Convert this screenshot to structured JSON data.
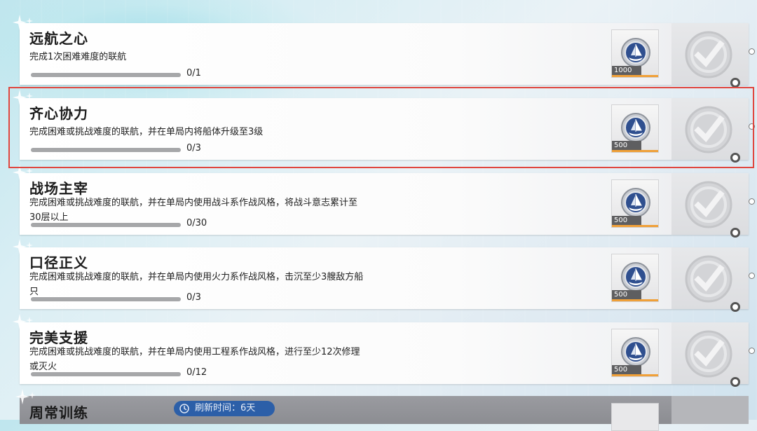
{
  "tasks": [
    {
      "title": "远航之心",
      "desc": "完成1次困难难度的联航",
      "progress_text": "0/1",
      "progress": 0,
      "reward_amount": "1000"
    },
    {
      "title": "齐心协力",
      "desc": "完成困难或挑战难度的联航，并在单局内将船体升级至3级",
      "progress_text": "0/3",
      "progress": 0,
      "reward_amount": "500"
    },
    {
      "title": "战场主宰",
      "desc": "完成困难或挑战难度的联航，并在单局内使用战斗系作战风格，将战斗意志累计至30层以上",
      "progress_text": "0/30",
      "progress": 0,
      "reward_amount": "500"
    },
    {
      "title": "口径正义",
      "desc": "完成困难或挑战难度的联航，并在单局内使用火力系作战风格，击沉至少3艘敌方船只",
      "progress_text": "0/3",
      "progress": 0,
      "reward_amount": "500"
    },
    {
      "title": "完美支援",
      "desc": "完成困难或挑战难度的联航，并在单局内使用工程系作战风格，进行至少12次修理或灭火",
      "progress_text": "0/12",
      "progress": 0,
      "reward_amount": "500"
    }
  ],
  "weekly_section": {
    "title": "周常训练",
    "refresh_label": "刷新时间：6天"
  },
  "colors": {
    "highlight": "#e0463e",
    "refresh_bg": "#2c5fa8",
    "reward_accent": "#f0a038"
  },
  "icons": {
    "reward": "ship-coin-icon",
    "claim": "checkmark-stamp-icon",
    "refresh": "clock-icon"
  }
}
